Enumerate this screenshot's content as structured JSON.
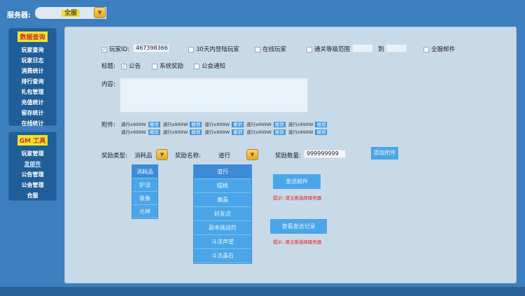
{
  "header": {
    "server_label": "服务器:",
    "server_value": "全服"
  },
  "sidebar": {
    "data_query": {
      "title": "数据查询",
      "items": [
        "玩家查询",
        "玩家日志",
        "消费统计",
        "排行查询",
        "礼包管理",
        "充值统计",
        "留存统计",
        "在线统计"
      ]
    },
    "gm_tools": {
      "title": "GM 工具",
      "items": [
        "玩家管理",
        "发邮件",
        "公告管理",
        "公会管理",
        "合服"
      ],
      "active_index": 1
    }
  },
  "form": {
    "player_id": {
      "label": "玩家ID:",
      "value": "467398366",
      "checked": true
    },
    "login_30d": {
      "label": "30天内登陆玩家",
      "checked": false
    },
    "online": {
      "label": "在线玩家",
      "checked": false
    },
    "level_range": {
      "label": "通关等级范围",
      "to": "到",
      "from_value": "",
      "to_value": "",
      "checked": false
    },
    "all_mail": {
      "label": "全服邮件",
      "checked": false
    },
    "title_label": "标题:",
    "title_options": [
      {
        "label": "公告",
        "checked": true
      },
      {
        "label": "系统奖励",
        "checked": false
      },
      {
        "label": "公会通知",
        "checked": false
      }
    ],
    "content_label": "内容:",
    "content_value": "",
    "attachment_label": "附件:",
    "attachments": [
      [
        {
          "item": "道行x999W",
          "revoke": "撤销"
        },
        {
          "item": "道行x999W",
          "revoke": "撤销"
        },
        {
          "item": "道行x999W",
          "revoke": "撤销"
        },
        {
          "item": "道行x999W",
          "revoke": "撤销"
        },
        {
          "item": "道行x999W",
          "revoke": "撤销"
        }
      ],
      [
        {
          "item": "道行x999W",
          "revoke": "撤销"
        },
        {
          "item": "道行x999W",
          "revoke": "撤销"
        },
        {
          "item": "道行x999W",
          "revoke": "撤销"
        },
        {
          "item": "道行x999W",
          "revoke": "撤销"
        },
        {
          "item": "道行x999W",
          "revoke": "撤销"
        }
      ]
    ],
    "reward_type": {
      "label": "奖励类型:",
      "value": "消耗品",
      "options": [
        "消耗品",
        "护法",
        "装备",
        "元神"
      ]
    },
    "reward_name": {
      "label": "奖励名称:",
      "value": "道行",
      "options": [
        "道行",
        "帽桃",
        "魔晶",
        "好友点",
        "副本挑战符",
        "斗法声望",
        "斗法晶石"
      ]
    },
    "reward_qty": {
      "label": "奖励数量:",
      "value": "999999999"
    },
    "add_attachment": "添加附件",
    "send_mail": "发送邮件",
    "send_hint": "提示: 请注意选择服务器",
    "view_records": "查看发送记录",
    "view_hint": "提示: 请注意选择服务器"
  }
}
